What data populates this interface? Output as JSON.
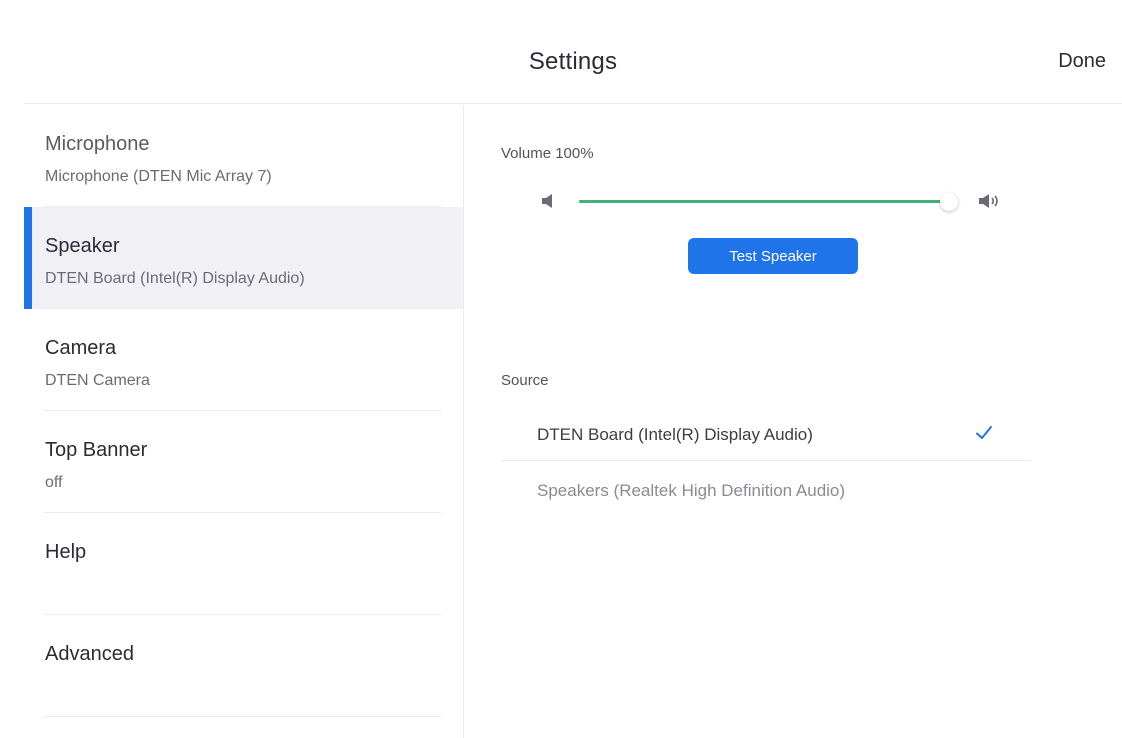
{
  "header": {
    "title": "Settings",
    "done_label": "Done"
  },
  "sidebar": {
    "items": [
      {
        "label": "Microphone",
        "sublabel": "Microphone (DTEN Mic Array 7)"
      },
      {
        "label": "Speaker",
        "sublabel": "DTEN Board (Intel(R) Display Audio)"
      },
      {
        "label": "Camera",
        "sublabel": "DTEN Camera"
      },
      {
        "label": "Top Banner",
        "sublabel": "off"
      },
      {
        "label": "Help",
        "sublabel": ""
      },
      {
        "label": "Advanced",
        "sublabel": ""
      }
    ],
    "selected_index": 1
  },
  "speaker": {
    "volume_label": "Volume 100%",
    "volume_fraction": 1.0,
    "test_label": "Test Speaker",
    "source_label": "Source",
    "sources": [
      {
        "label": "DTEN Board (Intel(R) Display Audio)",
        "selected": true
      },
      {
        "label": "Speakers (Realtek High Definition Audio)",
        "selected": false
      }
    ]
  },
  "colors": {
    "accent": "#1e74e8",
    "slider_fill": "#3fb37a",
    "selected_bg": "#f1f1f5"
  },
  "icons": {
    "volume_low": "speaker-low-icon",
    "volume_high": "speaker-high-icon",
    "check": "checkmark-icon"
  }
}
